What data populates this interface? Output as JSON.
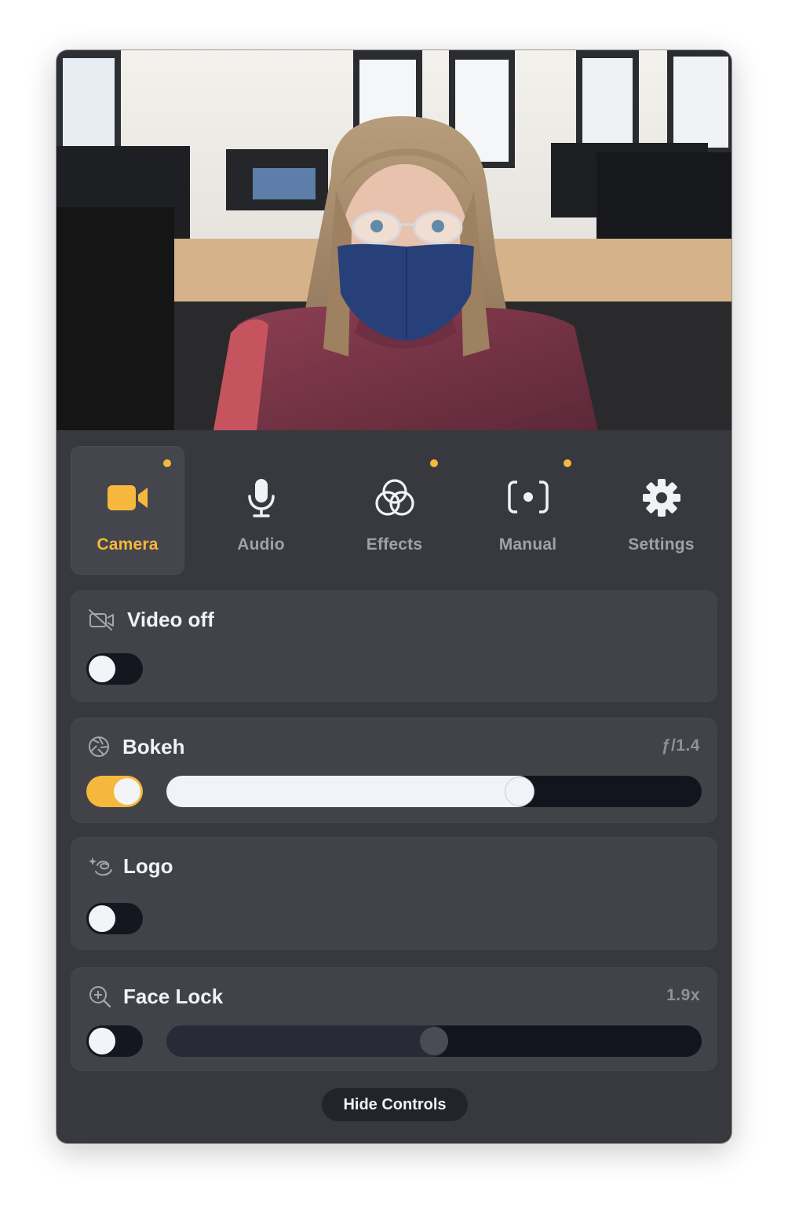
{
  "tabs": [
    {
      "key": "camera",
      "label": "Camera",
      "active": true,
      "dot": true
    },
    {
      "key": "audio",
      "label": "Audio",
      "active": false,
      "dot": false
    },
    {
      "key": "effects",
      "label": "Effects",
      "active": false,
      "dot": true
    },
    {
      "key": "manual",
      "label": "Manual",
      "active": false,
      "dot": true
    },
    {
      "key": "settings",
      "label": "Settings",
      "active": false,
      "dot": false
    }
  ],
  "cards": {
    "video_off": {
      "title": "Video off",
      "toggle_on": false,
      "icon": "video-off-icon"
    },
    "bokeh": {
      "title": "Bokeh",
      "value": "ƒ/1.4",
      "toggle_on": true,
      "slider_fraction": 0.66,
      "icon": "aperture-icon"
    },
    "logo": {
      "title": "Logo",
      "toggle_on": false,
      "icon": "logo-sparkle-icon"
    },
    "face_lock": {
      "title": "Face Lock",
      "value": "1.9x",
      "toggle_on": false,
      "slider_fraction": 0.5,
      "icon": "zoom-in-icon"
    }
  },
  "hide_controls_label": "Hide Controls",
  "colors": {
    "accent": "#f6b83c",
    "panel": "#38393f",
    "card": "#424349",
    "track": "#13141d"
  }
}
